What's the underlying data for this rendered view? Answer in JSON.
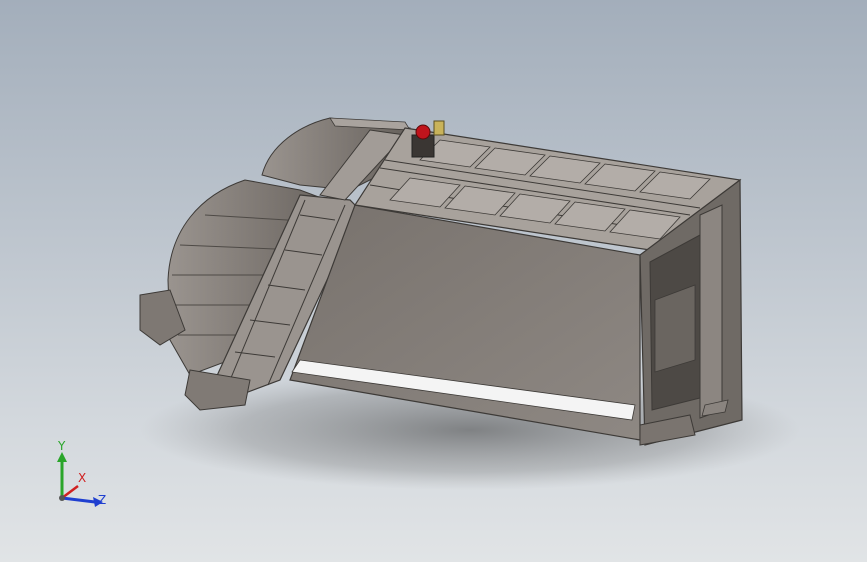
{
  "viewport": {
    "background_top": "#a3aebb",
    "background_bottom": "#e1e4e6"
  },
  "model": {
    "body_color": "#8b8580",
    "body_dark": "#6e6964",
    "body_light": "#a8a29c",
    "outline_color": "#3d3a37",
    "stripe_color": "#f4f4f4",
    "knob_red": "#c0141c",
    "knob_yellow": "#c9b35a"
  },
  "triad": {
    "y_label": "Y",
    "x_label": "X",
    "z_label": "Z",
    "y_color": "#2aa52a",
    "x_color": "#d02020",
    "z_color": "#1f3fd0"
  }
}
